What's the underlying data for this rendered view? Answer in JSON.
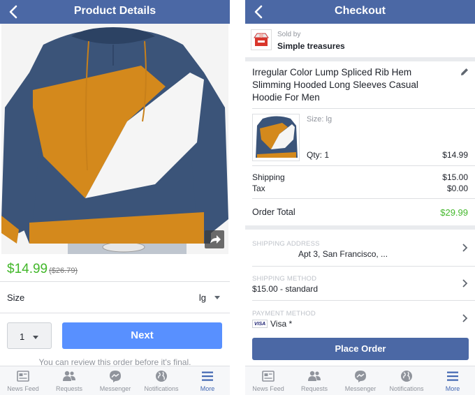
{
  "left_screen": {
    "title": "Product Details",
    "price": "$14.99",
    "old_price": "($26.79)",
    "size_label": "Size",
    "size_value": "lg",
    "quantity": "1",
    "next_label": "Next",
    "review_note": "You can review this order before it's final."
  },
  "right_screen": {
    "title": "Checkout",
    "sold_by_label": "Sold by",
    "seller_name": "Simple treasures",
    "product_title": "Irregular Color Lump Spliced Rib Hem Slimming Hooded Long Sleeves Casual Hoodie For Men",
    "size_text": "Size: lg",
    "qty_text": "Qty: 1",
    "item_price": "$14.99",
    "shipping_label": "Shipping",
    "shipping_value": "$15.00",
    "tax_label": "Tax",
    "tax_value": "$0.00",
    "order_total_label": "Order Total",
    "order_total_value": "$29.99",
    "shipping_address_label": "SHIPPING ADDRESS",
    "shipping_address_value": "Apt 3, San Francisco, ...",
    "shipping_method_label": "SHIPPING METHOD",
    "shipping_method_value": "$15.00 - standard",
    "payment_method_label": "PAYMENT METHOD",
    "visa_badge": "VISA",
    "payment_method_value": "Visa *",
    "place_order_label": "Place Order"
  },
  "tabbar": {
    "items": [
      {
        "label": "News Feed",
        "icon": "news-feed-icon"
      },
      {
        "label": "Requests",
        "icon": "requests-icon"
      },
      {
        "label": "Messenger",
        "icon": "messenger-icon"
      },
      {
        "label": "Notifications",
        "icon": "globe-icon"
      },
      {
        "label": "More",
        "icon": "menu-icon",
        "active": true
      }
    ]
  },
  "colors": {
    "header_blue": "#4b68a5",
    "next_button_blue": "#5890ff",
    "price_green": "#42b72a",
    "tab_active": "#4267b2",
    "hoodie_navy": "#3b5479",
    "hoodie_orange": "#d4891c"
  }
}
